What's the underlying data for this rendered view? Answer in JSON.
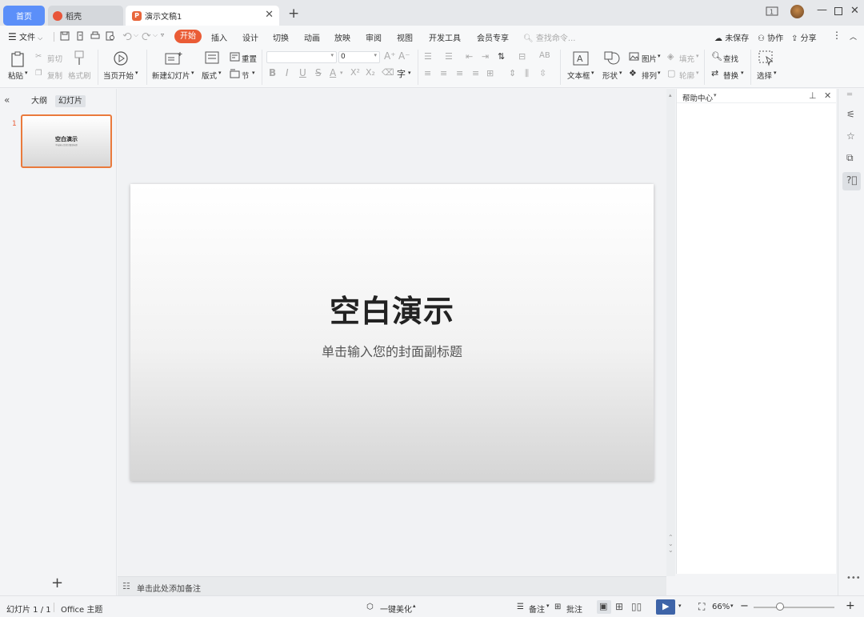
{
  "tabs": {
    "home": "首页",
    "dk": "稻壳",
    "doc": "演示文稿1"
  },
  "menu": {
    "file": "文件",
    "items": [
      "开始",
      "插入",
      "设计",
      "切换",
      "动画",
      "放映",
      "审阅",
      "视图",
      "开发工具",
      "会员专享"
    ],
    "search_placeholder": "查找命令...",
    "unsaved": "未保存",
    "collab": "协作",
    "share": "分享"
  },
  "ribbon": {
    "paste": "粘贴",
    "cut": "剪切",
    "copy": "复制",
    "format_painter": "格式刷",
    "from_current": "当页开始",
    "new_slide": "新建幻灯片",
    "layout": "版式",
    "reset": "重置",
    "section": "节",
    "font_size": "0",
    "textbox": "文本框",
    "shape": "形状",
    "picture": "图片",
    "arrange": "排列",
    "fill": "填充",
    "outline": "轮廓",
    "find": "查找",
    "replace": "替换",
    "select": "选择"
  },
  "left_panel": {
    "outline_tab": "大纲",
    "slides_tab": "幻灯片",
    "slide_number": "1",
    "thumb_title": "空白演示",
    "thumb_subtitle": "单击输入您的封面副标题"
  },
  "slide": {
    "title": "空白演示",
    "subtitle": "单击输入您的封面副标题"
  },
  "notes_placeholder": "单击此处添加备注",
  "help_panel": {
    "title": "帮助中心"
  },
  "status": {
    "slide_info": "幻灯片 1 / 1",
    "theme": "Office 主题",
    "beautify": "一键美化",
    "notes": "备注",
    "comment": "批注",
    "zoom": "66%",
    "zoom_level": 0.66
  },
  "colors": {
    "accent_orange": "#ea5c36",
    "home_tab_blue": "#5b8ff9",
    "play_blue": "#3e64a8"
  }
}
